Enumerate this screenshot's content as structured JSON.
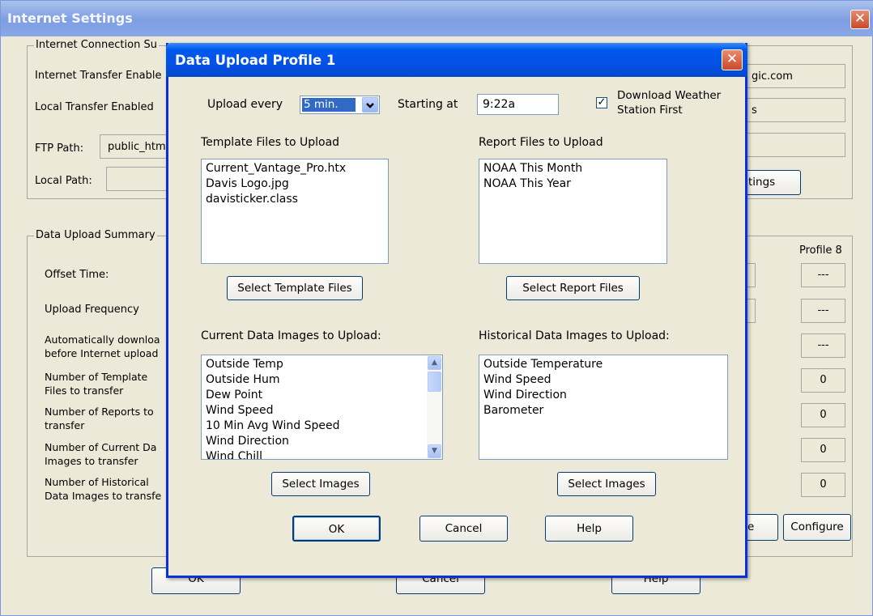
{
  "background_window": {
    "title": "Internet Settings",
    "connection_group": "Internet Connection Su",
    "internet_transfer": "Internet Transfer Enable",
    "local_transfer": "Local Transfer Enabled",
    "ftp_path_label": "FTP Path:",
    "ftp_path_value": "public_htm",
    "local_path_label": "Local Path:",
    "right_field_1": "gic.com",
    "right_field_2": "s",
    "settings_button": "tings",
    "summary_group": "Data Upload Summary",
    "offset_time": "Offset Time:",
    "upload_frequency": "Upload Frequency",
    "auto_download_1": "Automatically downloa",
    "auto_download_2": "before Internet upload",
    "num_template_1": "Number of Template",
    "num_template_2": "Files to transfer",
    "num_reports_1": "Number of Reports to",
    "num_reports_2": "transfer",
    "num_current_1": "Number of Current Da",
    "num_current_2": "Images to transfer",
    "num_hist_1": "Number of Historical",
    "num_hist_2": "Data Images to transfe",
    "profile8_header": "Profile 8",
    "profile8_values": [
      "---",
      "---",
      "---",
      "0",
      "0",
      "0",
      "0"
    ],
    "partial_button": "e",
    "configure_button": "Configure",
    "ok_button": "OK",
    "cancel_button": "Cancel",
    "help_button": "Help"
  },
  "dialog": {
    "title": "Data Upload Profile 1",
    "upload_every_label": "Upload every",
    "upload_every_value": "5 min.",
    "starting_at_label": "Starting at",
    "starting_at_value": "9:22a",
    "download_first_line1": "Download Weather",
    "download_first_line2": "Station First",
    "download_first_checked": true,
    "template_files_label": "Template Files to Upload",
    "template_files": [
      "Current_Vantage_Pro.htx",
      "Davis Logo.jpg",
      "davisticker.class"
    ],
    "select_template_button": "Select Template Files",
    "report_files_label": "Report Files to Upload",
    "report_files": [
      "NOAA This Month",
      "NOAA This Year"
    ],
    "select_report_button": "Select Report Files",
    "current_images_label": "Current Data Images to Upload:",
    "current_images": [
      "Outside Temp",
      "Outside Hum",
      "Dew Point",
      "Wind Speed",
      "10 Min Avg Wind Speed",
      "Wind Direction",
      "Wind Chill"
    ],
    "select_current_images_button": "Select Images",
    "historical_images_label": "Historical Data Images to Upload:",
    "historical_images": [
      "Outside Temperature",
      "Wind Speed",
      "Wind Direction",
      "Barometer"
    ],
    "select_historical_images_button": "Select Images",
    "ok_button": "OK",
    "cancel_button": "Cancel",
    "help_button": "Help"
  },
  "colors": {
    "dialog_title": "#0452e6",
    "selection": "#316ac5",
    "window_face": "#ece9d8",
    "close_button": "#c84a2a"
  },
  "icons": {
    "close": "close-icon",
    "combo": "chevron-down-icon",
    "scroll_up": "scroll-up-icon",
    "scroll_down": "scroll-down-icon",
    "check": "checkmark-icon"
  }
}
